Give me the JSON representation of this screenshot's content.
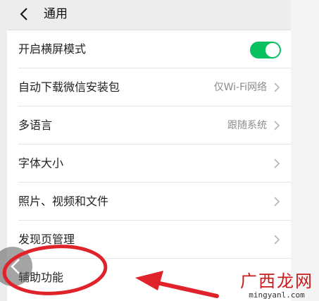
{
  "header": {
    "title": "通用"
  },
  "settings": [
    {
      "label": "开启横屏模式",
      "value": "",
      "control": "toggle",
      "checked": true
    },
    {
      "label": "自动下载微信安装包",
      "value": "仅Wi-Fi网络",
      "control": "chevron"
    },
    {
      "label": "多语言",
      "value": "跟随系统",
      "control": "chevron"
    },
    {
      "label": "字体大小",
      "value": "",
      "control": "chevron"
    },
    {
      "label": "照片、视频和文件",
      "value": "",
      "control": "chevron"
    },
    {
      "label": "发现页管理",
      "value": "",
      "control": "chevron"
    },
    {
      "label": "辅助功能",
      "value": "",
      "control": "none"
    }
  ],
  "watermark": {
    "chinese": "广西龙网",
    "latin": "mingyanl.com"
  },
  "colors": {
    "toggle_on": "#07c160",
    "annotation": "#e0232b",
    "navbar_bg": "#ededed"
  }
}
